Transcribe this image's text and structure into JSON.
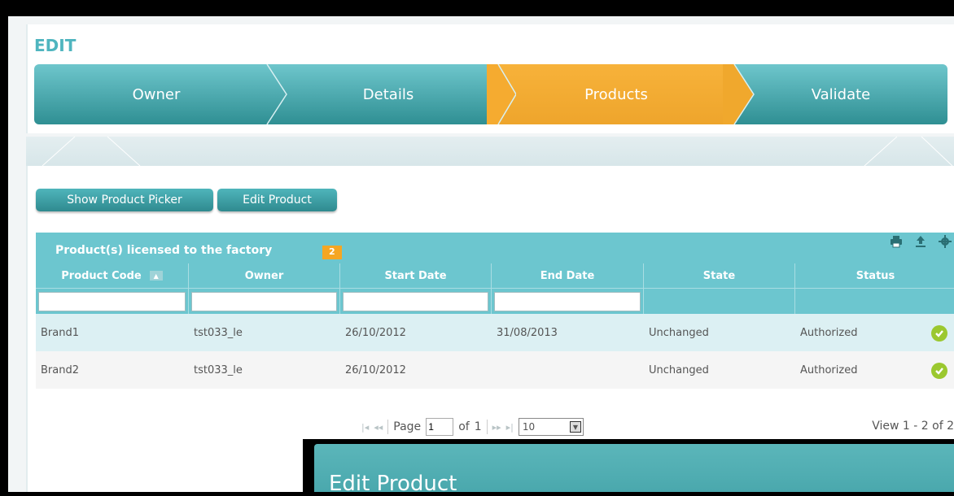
{
  "window": {
    "title": ""
  },
  "edit": {
    "title": "EDIT"
  },
  "wizard": {
    "steps": [
      {
        "label": "Owner"
      },
      {
        "label": "Details"
      },
      {
        "label": "Products"
      },
      {
        "label": "Validate"
      }
    ],
    "active": "Products"
  },
  "toolbar": {
    "show_picker_label": "Show Product Picker",
    "edit_product_label": "Edit Product"
  },
  "grid": {
    "caption": "Product(s) licensed to the factory",
    "count": "2",
    "icons": [
      "print-icon",
      "export-icon",
      "settings-icon"
    ],
    "columns": [
      "Product Code",
      "Owner",
      "Start Date",
      "End Date",
      "State",
      "Status"
    ],
    "rows": [
      {
        "product_code": "Brand1",
        "owner": "tst033_le",
        "start_date": "26/10/2012",
        "end_date": "31/08/2013",
        "state": "Unchanged",
        "status": "Authorized"
      },
      {
        "product_code": "Brand2",
        "owner": "tst033_le",
        "start_date": "26/10/2012",
        "end_date": "",
        "state": "Unchanged",
        "status": "Authorized"
      }
    ]
  },
  "pager": {
    "page_label": "Page",
    "page_value": "1",
    "of_label": "of",
    "total_pages": "1",
    "rows_per_page": "10",
    "view_text": "View 1 - 2 of 2"
  },
  "dialog": {
    "title": "Edit Product"
  },
  "colors": {
    "accent": "#6cc6cf",
    "wizard_active": "#f5a623",
    "status_ok": "#9bc82f"
  }
}
